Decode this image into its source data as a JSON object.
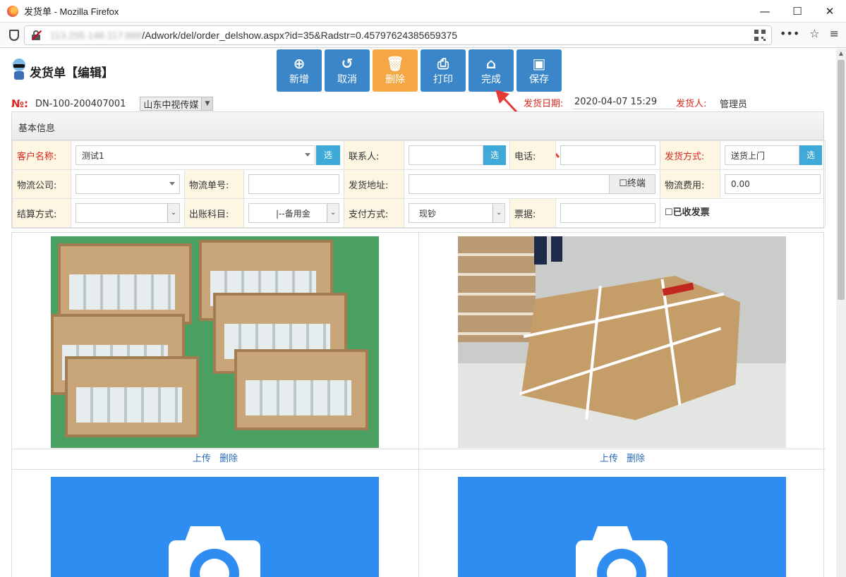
{
  "browser": {
    "window_title": "发货单 - Mozilla Firefox",
    "url_host": "113.255.148.117:888",
    "url_path": "/Adwork/del/order_delshow.aspx?id=35&Radstr=0.45797624385659375",
    "minimize": "—",
    "maximize": "☐",
    "close": "✕",
    "more": "•••",
    "star": "☆",
    "menu": "≡"
  },
  "page": {
    "title": "发货单【编辑】",
    "toolbar": [
      {
        "label": "新增",
        "icon": "plus-circle-icon",
        "glyph": "⊕"
      },
      {
        "label": "取消",
        "icon": "undo-icon",
        "glyph": "↺"
      },
      {
        "label": "删除",
        "icon": "trash-icon",
        "glyph": "🗑"
      },
      {
        "label": "打印",
        "icon": "print-icon",
        "glyph": "⎙"
      },
      {
        "label": "完成",
        "icon": "tag-icon",
        "glyph": "⌂"
      },
      {
        "label": "保存",
        "icon": "save-icon",
        "glyph": "▣"
      }
    ],
    "order_no_label": "№:",
    "order_no": "DN-100-200407001",
    "company_select": "山东中视传媒",
    "ship_date_label": "发货日期:",
    "ship_date": "2020-04-07 15:29",
    "shipper_label": "发货人:",
    "shipper": "管理员",
    "colors": {
      "primary": "#3a86c8",
      "delete": "#f4a742",
      "required": "#d9281e",
      "select_btn": "#3fa9d8",
      "placeholder_bg": "#2f8cf0"
    }
  },
  "panel": {
    "title": "基本信息",
    "customer_label": "客户名称:",
    "customer_value": "测试1",
    "select_btn": "选",
    "contact_label": "联系人:",
    "contact_value": "",
    "phone_label": "电话:",
    "phone_value": "",
    "ship_method_label": "发货方式:",
    "ship_method_value": "送货上门",
    "logistics_label": "物流公司:",
    "logistics_value": "",
    "waybill_label": "物流单号:",
    "waybill_value": "",
    "address_label": "发货地址:",
    "address_value": "",
    "terminal_label": "☐终端",
    "fee_label": "物流费用:",
    "fee_value": "0.00",
    "settle_label": "结算方式:",
    "settle_value": "",
    "account_label": "出账科目:",
    "account_value": "|--备用金",
    "pay_label": "支付方式:",
    "pay_value": "现钞",
    "bill_label": "票据:",
    "bill_value": "",
    "invoice_label": "☐已收发票"
  },
  "gallery": {
    "upload": "上传",
    "delete": "删除"
  }
}
